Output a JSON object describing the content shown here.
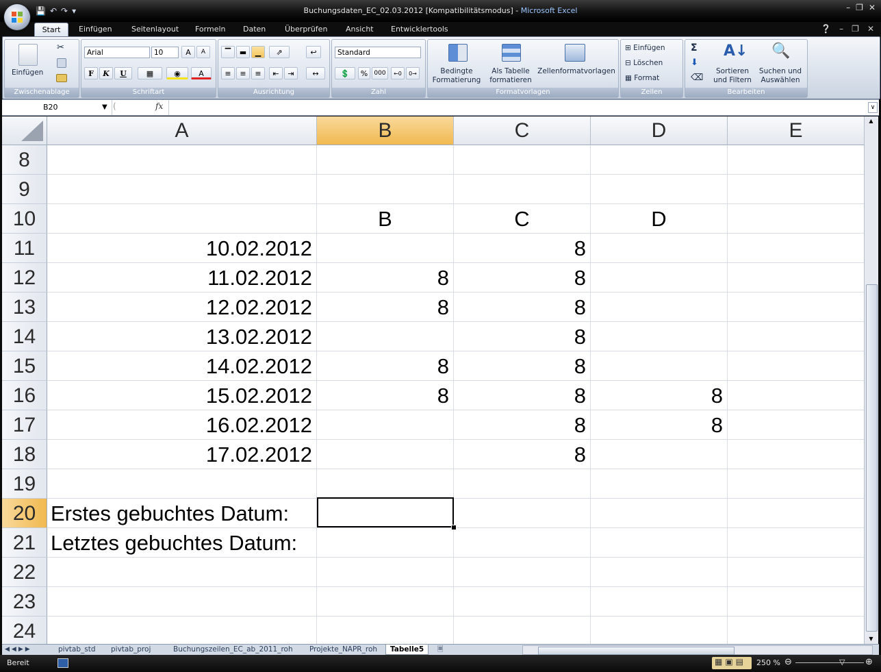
{
  "window": {
    "title_prefix": "Buchungsdaten_EC_02.03.2012  [Kompatibilitätsmodus] - ",
    "title_app": "Microsoft Excel"
  },
  "ribbon_tabs": [
    "Start",
    "Einfügen",
    "Seitenlayout",
    "Formeln",
    "Daten",
    "Überprüfen",
    "Ansicht",
    "Entwicklertools"
  ],
  "ribbon": {
    "clipboard": {
      "paste_label": "Einfügen",
      "group_label": "Zwischenablage"
    },
    "font": {
      "font_name": "Arial",
      "font_size": "10",
      "bold": "F",
      "italic": "K",
      "underline": "U",
      "group_label": "Schriftart"
    },
    "alignment": {
      "group_label": "Ausrichtung"
    },
    "number": {
      "format": "Standard",
      "percent": "%",
      "thousands": "000",
      "group_label": "Zahl"
    },
    "styles": {
      "conditional": [
        "Bedingte",
        "Formatierung"
      ],
      "as_table": [
        "Als Tabelle",
        "formatieren"
      ],
      "cell_styles": "Zellenformatvorlagen",
      "group_label": "Formatvorlagen"
    },
    "cells": {
      "insert": "Einfügen",
      "delete": "Löschen",
      "format": "Format",
      "group_label": "Zellen"
    },
    "editing": {
      "sigma": "Σ",
      "sort": [
        "Sortieren",
        "und Filtern"
      ],
      "find": [
        "Suchen und",
        "Auswählen"
      ],
      "group_label": "Bearbeiten"
    }
  },
  "formula_bar": {
    "name_box": "B20",
    "fx": "fx",
    "formula": ""
  },
  "columns": [
    "A",
    "B",
    "C",
    "D",
    "E"
  ],
  "selected_column": "B",
  "rows": [
    {
      "num": "8",
      "A": "",
      "B": "",
      "C": "",
      "D": ""
    },
    {
      "num": "9",
      "A": "",
      "B": "",
      "C": "",
      "D": ""
    },
    {
      "num": "10",
      "A": "",
      "B": "B",
      "C": "C",
      "D": "D"
    },
    {
      "num": "11",
      "A": "10.02.2012",
      "B": "",
      "C": "8",
      "D": ""
    },
    {
      "num": "12",
      "A": "11.02.2012",
      "B": "8",
      "C": "8",
      "D": ""
    },
    {
      "num": "13",
      "A": "12.02.2012",
      "B": "8",
      "C": "8",
      "D": ""
    },
    {
      "num": "14",
      "A": "13.02.2012",
      "B": "",
      "C": "8",
      "D": ""
    },
    {
      "num": "15",
      "A": "14.02.2012",
      "B": "8",
      "C": "8",
      "D": ""
    },
    {
      "num": "16",
      "A": "15.02.2012",
      "B": "8",
      "C": "8",
      "D": "8"
    },
    {
      "num": "17",
      "A": "16.02.2012",
      "B": "",
      "C": "8",
      "D": "8"
    },
    {
      "num": "18",
      "A": "17.02.2012",
      "B": "",
      "C": "8",
      "D": ""
    },
    {
      "num": "19",
      "A": "",
      "B": "",
      "C": "",
      "D": ""
    },
    {
      "num": "20",
      "A": "Erstes gebuchtes Datum:",
      "B": "",
      "C": "",
      "D": ""
    },
    {
      "num": "21",
      "A": "Letztes gebuchtes Datum:",
      "B": "",
      "C": "",
      "D": ""
    },
    {
      "num": "22",
      "A": "",
      "B": "",
      "C": "",
      "D": ""
    },
    {
      "num": "23",
      "A": "",
      "B": "",
      "C": "",
      "D": ""
    },
    {
      "num": "24",
      "A": "",
      "B": "",
      "C": "",
      "D": ""
    }
  ],
  "selected_row": "20",
  "sheet_tabs": [
    "pivtab_std",
    "pivtab_proj",
    "Buchungszeilen_EC_ab_2011_roh",
    "Projekte_NAPR_roh",
    "Tabelle5"
  ],
  "active_sheet": "Tabelle5",
  "status": {
    "mode": "Bereit",
    "zoom": "250 %"
  }
}
